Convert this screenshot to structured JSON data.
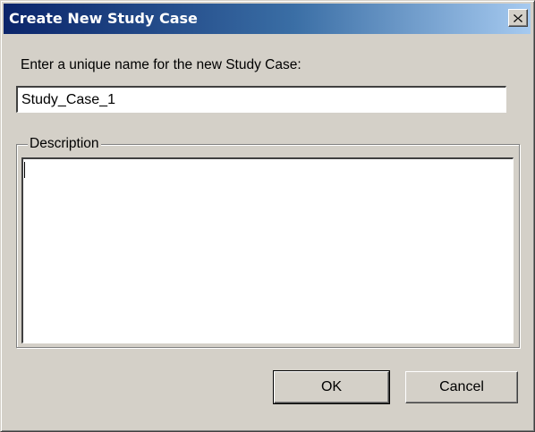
{
  "window": {
    "title": "Create New Study Case",
    "close_icon": "close-icon"
  },
  "form": {
    "prompt_label": "Enter a unique name for the new Study Case:",
    "name_value": "Study_Case_1",
    "description_label": "Description",
    "description_value": ""
  },
  "buttons": {
    "ok_label": "OK",
    "cancel_label": "Cancel"
  },
  "colors": {
    "titlebar_start": "#0a246a",
    "titlebar_end": "#a6caf0",
    "face": "#d4d0c8"
  }
}
